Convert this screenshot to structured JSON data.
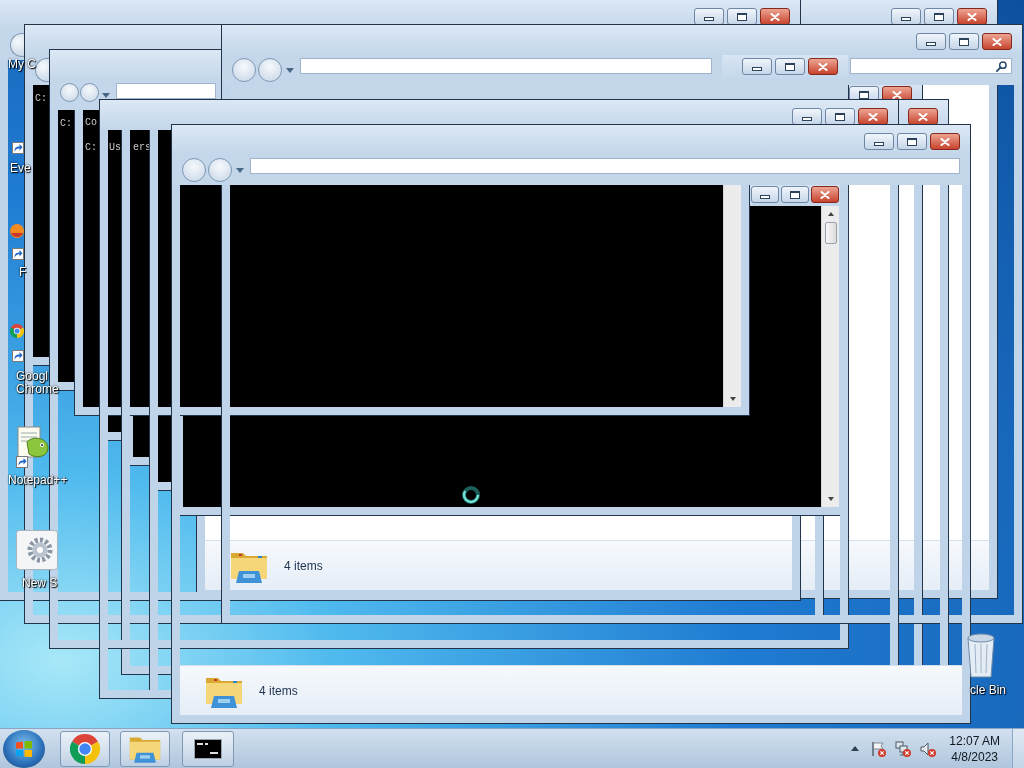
{
  "desktop_icons": [
    {
      "label": "My C",
      "shortcut": false
    },
    {
      "label": "Eve",
      "shortcut": true
    },
    {
      "label": "F",
      "kind": "round-app",
      "shortcut": true
    },
    {
      "label": "Googl Chrome",
      "kind": "browser",
      "shortcut": true
    },
    {
      "label": "Notepad++",
      "kind": "notepad",
      "shortcut": true
    },
    {
      "label": "New S",
      "kind": "settings",
      "shortcut": false
    },
    {
      "label": "cle Bin",
      "kind": "recycle-bin",
      "shortcut": false
    }
  ],
  "windows": [
    {
      "kind": "explorer",
      "status": "4 items"
    },
    {
      "kind": "console",
      "texts": [
        "C:"
      ]
    },
    {
      "kind": "console",
      "texts": [
        "C:"
      ]
    },
    {
      "kind": "console"
    },
    {
      "kind": "console"
    },
    {
      "kind": "console"
    },
    {
      "kind": "explorer"
    },
    {
      "kind": "explorer"
    },
    {
      "kind": "console"
    },
    {
      "kind": "console",
      "texts": [
        "Co",
        "C:",
        "Us",
        "ers"
      ]
    },
    {
      "kind": "explorer"
    },
    {
      "kind": "explorer"
    },
    {
      "kind": "explorer"
    },
    {
      "kind": "explorer"
    },
    {
      "kind": "explorer"
    },
    {
      "kind": "explorer",
      "status": "4 items"
    }
  ],
  "taskbar": {
    "apps": [
      {
        "kind": "browser",
        "running": true
      },
      {
        "kind": "explorer",
        "running": true
      },
      {
        "kind": "console",
        "running": true
      }
    ],
    "clock": {
      "time": "12:07 AM",
      "date": "4/8/2023"
    }
  }
}
